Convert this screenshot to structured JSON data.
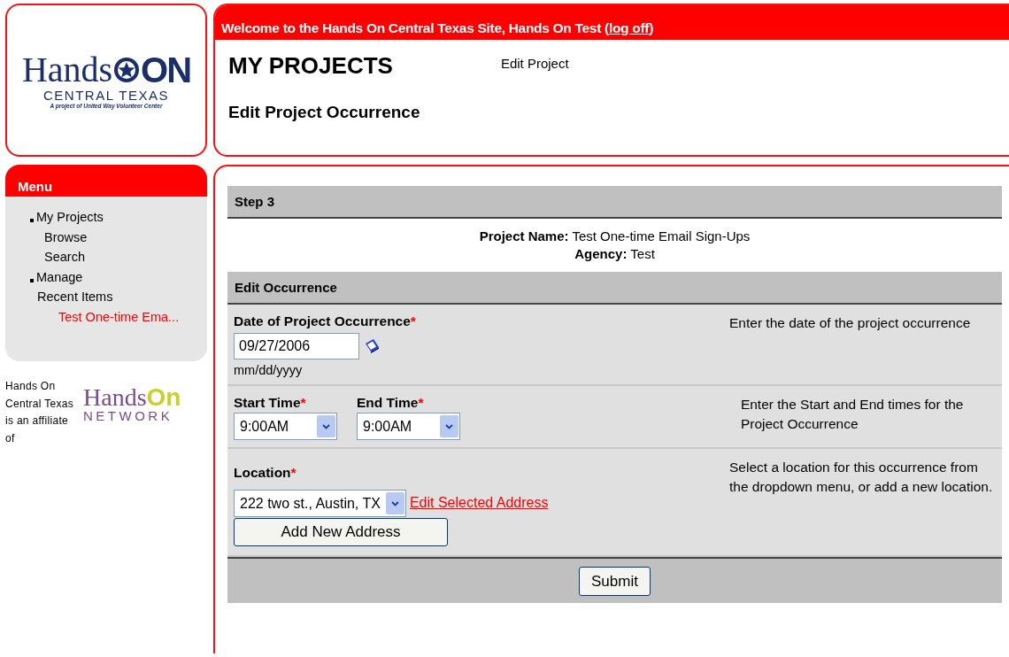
{
  "logo": {
    "word": "Hands",
    "on": "ON",
    "region": "CENTRAL TEXAS",
    "tagline": "A project of United Way Volunteer Center"
  },
  "header": {
    "welcome": "Welcome to the Hands On Central Texas Site, Hands On Test (",
    "logoff": "log off",
    "welcome_end": ")",
    "title": "MY PROJECTS",
    "breadcrumb": "Edit Project",
    "subtitle": "Edit Project Occurrence"
  },
  "menu": {
    "title": "Menu",
    "items": [
      {
        "label": "My Projects",
        "bullet": true,
        "color": "#000000",
        "children": [
          {
            "label": "Browse",
            "bullet": false,
            "color": "#000000"
          },
          {
            "label": "Search",
            "bullet": false,
            "color": "#000000"
          }
        ]
      },
      {
        "label": "Manage",
        "bullet": true,
        "color": "#000000"
      },
      {
        "label": "Recent Items",
        "bullet": false,
        "color": "#000000",
        "children": [
          {
            "label": "Test One-time Ema...",
            "bullet": false,
            "color": "#ff0000"
          }
        ]
      }
    ]
  },
  "affiliate": {
    "text": "Hands On Central Texas is an affiliate of",
    "logo_word": "Hands",
    "logo_on": "On",
    "logo_sub": "NETWORK"
  },
  "form": {
    "step": "Step 3",
    "project_label": "Project Name:",
    "project_name": "Test One-time Email Sign-Ups",
    "agency_label": "Agency:",
    "agency": "Test",
    "section": "Edit Occurrence",
    "rows": [
      {
        "kind": "date",
        "fields": [
          {
            "label": "Date of Project Occurrence",
            "required": "*",
            "value": "09/27/2006",
            "hint": "mm/dd/yyyy"
          }
        ],
        "help": "Enter the date of the project occurrence"
      },
      {
        "kind": "times",
        "fields": [
          {
            "label": "Start Time",
            "required": "*",
            "value": "9:00AM"
          },
          {
            "label": "End Time",
            "required": "*",
            "value": "9:00AM"
          }
        ],
        "help": "Enter the Start and End times for the Project Occurrence"
      },
      {
        "kind": "location",
        "fields": [
          {
            "label": "Location",
            "required": "*",
            "value": "222 two st., Austin, TX",
            "link": "Edit Selected Address",
            "button": "Add New Address"
          }
        ],
        "help": "Select a location for this occurrence from the dropdown menu, or add a new location."
      }
    ],
    "submit": "Submit"
  }
}
